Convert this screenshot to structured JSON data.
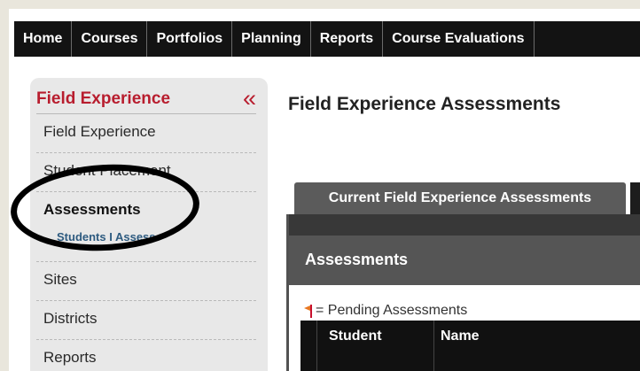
{
  "topnav": {
    "items": [
      "Home",
      "Courses",
      "Portfolios",
      "Planning",
      "Reports",
      "Course Evaluations"
    ]
  },
  "sidebar": {
    "title": "Field Experience",
    "collapse_glyph": "«",
    "items": [
      {
        "label": "Field Experience"
      },
      {
        "label": "Student Placement"
      },
      {
        "label": "Assessments"
      },
      {
        "label": "Sites"
      },
      {
        "label": "Districts"
      },
      {
        "label": "Reports"
      }
    ],
    "subitem": "Students I Assess"
  },
  "main": {
    "page_title": "Field Experience Assessments",
    "tab_label": "Current Field Experience Assessments",
    "panel_title": "Assessments",
    "legend_text": "= Pending Assessments",
    "table_headers": [
      "Student",
      "Name"
    ]
  },
  "colors": {
    "nav_bg": "#131313",
    "accent_red": "#b81d2e",
    "link_blue": "#2e5b80",
    "sidebar_bg": "#e8e8e8"
  }
}
